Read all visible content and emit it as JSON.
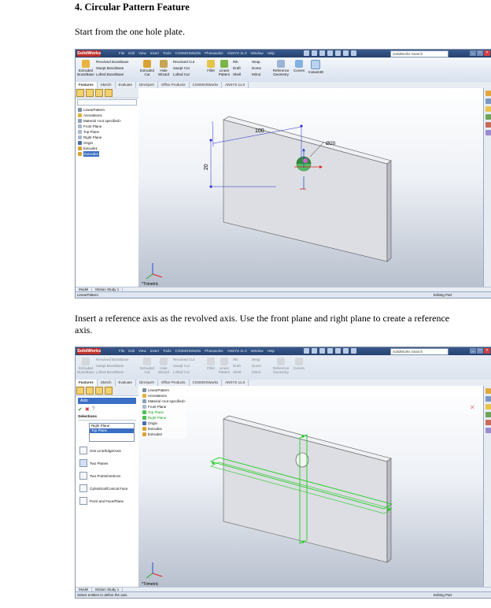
{
  "document": {
    "heading": "4. Circular Pattern Feature",
    "paragraph1": "Start from the one hole plate.",
    "paragraph2": "Insert a reference axis as the revolved axis. Use the front plane and right plane to create a reference axis."
  },
  "app": {
    "logo": "SolidWorks",
    "menus": [
      "File",
      "Edit",
      "View",
      "Insert",
      "Tools",
      "COSMOSWorks",
      "Photoworks",
      "ANSYS 11.0",
      "Window",
      "Help"
    ],
    "part_name": "LinearPattern",
    "search_placeholder": "SolidWorks Search",
    "ribbon": {
      "extruded_boss": "Extruded Boss/Base",
      "revolved_boss": "Revolved Boss/Base",
      "swept_boss": "Swept Boss/Base",
      "lofted_boss": "Lofted Boss/Base",
      "extruded_cut": "Extruded Cut",
      "hole_wizard": "Hole Wizard",
      "revolved_cut": "Revolved Cut",
      "swept_cut": "Swept Cut",
      "lofted_cut": "Lofted Cut",
      "fillet": "Fillet",
      "linear_pattern": "Linear Pattern",
      "rib": "Rib",
      "draft": "Draft",
      "shell": "Shell",
      "wrap": "Wrap",
      "dome": "Dome",
      "mirror": "Mirror",
      "reference_geometry": "Reference Geometry",
      "curves": "Curves",
      "instant3d": "Instant3D"
    },
    "tabs": [
      "Features",
      "Sketch",
      "Evaluate",
      "DimXpert",
      "Office Products",
      "COSMOSWorks",
      "ANSYS 11.0"
    ]
  },
  "screen1": {
    "tree": [
      "LinearPattern",
      "Annotations",
      "Material <not specified>",
      "Front Plane",
      "Top Plane",
      "Right Plane",
      "Origin",
      "Extrude1",
      "Extrude2"
    ],
    "dim_100": "100",
    "dim_20": "20",
    "dim_hole": "Ø20",
    "view_label": "*Trimetric",
    "bottom_tabs": [
      "Model",
      "Motion Study 1"
    ],
    "status_left": "LinearPattern",
    "status_right": "Editing Part"
  },
  "screen2": {
    "pm_title": "Axis",
    "selections_label": "Selections",
    "selected": [
      "Right Plane",
      "Top Plane"
    ],
    "options": [
      "One Line/Edge/Axis",
      "Two Planes",
      "Two Points/Vertices",
      "Cylindrical/Conical Face",
      "Point and Face/Plane"
    ],
    "tree": [
      "LinearPattern",
      "Annotations",
      "Material <not specified>",
      "Front Plane",
      "Top Plane",
      "Right Plane",
      "Origin",
      "Extrude1",
      "Extrude2"
    ],
    "view_label": "*Trimetric",
    "bottom_tabs": [
      "Model",
      "Motion Study 1"
    ],
    "status_left": "Select entities to define the axis.",
    "status_right": "Editing Part"
  },
  "colors": {
    "selection_green": "#22cc22",
    "tree_highlight": "#3a6fc4",
    "title_blue": "#24416e",
    "logo_red": "#c0302b"
  }
}
